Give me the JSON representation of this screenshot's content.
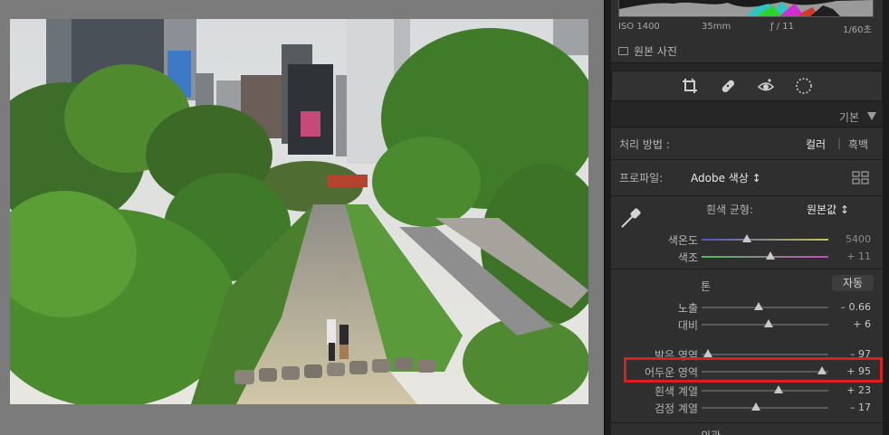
{
  "histogram_meta": {
    "iso": "ISO 1400",
    "focal": "35mm",
    "aperture": "ƒ / 11",
    "shutter": "1/60초"
  },
  "original_photo_label": "원본 사진",
  "section": {
    "title": "기본"
  },
  "treatment": {
    "label": "처리 방법 :",
    "color": "컬러",
    "separator": "|",
    "bw": "흑백"
  },
  "profile": {
    "label": "프로파일:",
    "value": "Adobe 색상 ↕"
  },
  "white_balance": {
    "label": "흰색 균형:",
    "value": "원본값 ↕"
  },
  "sliders": {
    "temp": {
      "label": "색온도",
      "value": "5400",
      "position": 0.36
    },
    "tint": {
      "label": "색조",
      "value": "+ 11",
      "position": 0.54
    },
    "exposure": {
      "label": "노출",
      "value": "– 0.66",
      "position": 0.45
    },
    "contrast": {
      "label": "대비",
      "value": "+ 6",
      "position": 0.53
    },
    "highlights": {
      "label": "밝은 영역",
      "value": "– 97",
      "position": 0.05
    },
    "shadows": {
      "label": "어두운 영역",
      "value": "+ 95",
      "position": 0.95
    },
    "whites": {
      "label": "흰색 계열",
      "value": "+ 23",
      "position": 0.61
    },
    "blacks": {
      "label": "검정 계열",
      "value": "– 17",
      "position": 0.43
    }
  },
  "tone": {
    "label": "톤",
    "auto": "자동"
  },
  "presence_label": "외관",
  "colors": {
    "highlight_box": "#d91f1f",
    "temp_track_start": "#4a55c8",
    "temp_track_end": "#c8c24a",
    "tint_track_start": "#4bbf55",
    "tint_track_end": "#bf4bbf"
  }
}
